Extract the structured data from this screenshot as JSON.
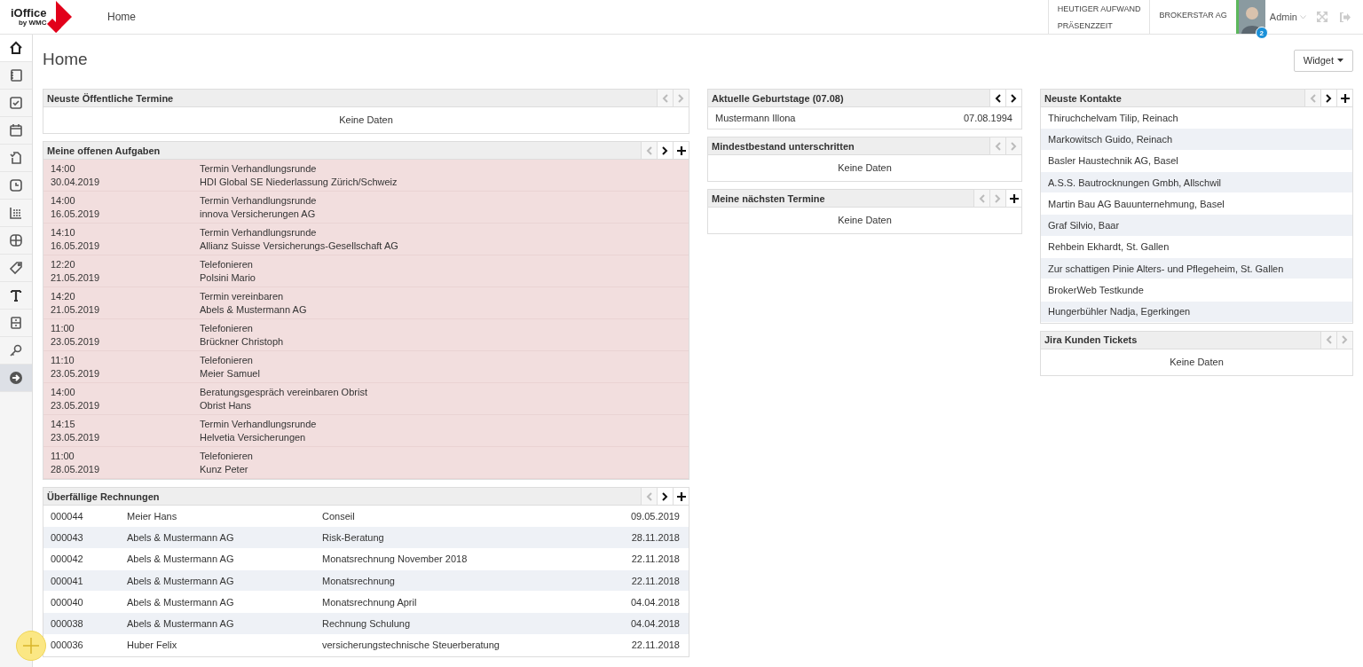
{
  "header": {
    "logo": {
      "name": "iOffice",
      "tagline": "by WMC"
    },
    "title": "Home",
    "stats": [
      "HEUTIGER AUFWAND",
      "PRÄSENZZEIT"
    ],
    "company": "BROKERSTAR AG",
    "user": {
      "name": "Admin",
      "badge": "2"
    }
  },
  "sidebar": {
    "items": [
      {
        "selected": false
      },
      {
        "selected": false
      },
      {
        "selected": false
      },
      {
        "selected": false
      },
      {
        "selected": false
      },
      {
        "selected": false
      },
      {
        "selected": false
      },
      {
        "selected": false
      },
      {
        "selected": false
      },
      {
        "selected": false
      },
      {
        "selected": false
      },
      {
        "selected": false
      },
      {
        "selected": true
      }
    ]
  },
  "page": {
    "title": "Home",
    "widget_button": "Widget"
  },
  "columns": [
    [
      {
        "kind": "empty",
        "title": "Neuste Öffentliche Termine",
        "buttons": [
          {
            "kind": "prev",
            "disabled": true
          },
          {
            "kind": "next",
            "disabled": true
          }
        ],
        "message": "Keine Daten"
      },
      {
        "kind": "tasks",
        "title": "Meine offenen Aufgaben",
        "buttons": [
          {
            "kind": "prev",
            "disabled": true
          },
          {
            "kind": "next",
            "disabled": false
          },
          {
            "kind": "add",
            "disabled": false
          }
        ],
        "rows": [
          {
            "time": "14:00",
            "date": "30.04.2019",
            "title": "Termin Verhandlungsrunde",
            "subject": "HDI Global SE Niederlassung Zürich/Schweiz"
          },
          {
            "time": "14:00",
            "date": "16.05.2019",
            "title": "Termin Verhandlungsrunde",
            "subject": "innova Versicherungen AG"
          },
          {
            "time": "14:10",
            "date": "16.05.2019",
            "title": "Termin Verhandlungsrunde",
            "subject": "Allianz Suisse Versicherungs-Gesellschaft AG"
          },
          {
            "time": "12:20",
            "date": "21.05.2019",
            "title": "Telefonieren",
            "subject": "Polsini Mario"
          },
          {
            "time": "14:20",
            "date": "21.05.2019",
            "title": "Termin vereinbaren",
            "subject": "Abels & Mustermann AG"
          },
          {
            "time": "11:00",
            "date": "23.05.2019",
            "title": "Telefonieren",
            "subject": "Brückner Christoph"
          },
          {
            "time": "11:10",
            "date": "23.05.2019",
            "title": "Telefonieren",
            "subject": "Meier Samuel"
          },
          {
            "time": "14:00",
            "date": "23.05.2019",
            "title": "Beratungsgespräch vereinbaren Obrist",
            "subject": "Obrist Hans"
          },
          {
            "time": "14:15",
            "date": "23.05.2019",
            "title": "Termin Verhandlungsrunde",
            "subject": "Helvetia Versicherungen"
          },
          {
            "time": "11:00",
            "date": "28.05.2019",
            "title": "Telefonieren",
            "subject": "Kunz Peter"
          }
        ]
      },
      {
        "kind": "table",
        "title": "Überfällige Rechnungen",
        "buttons": [
          {
            "kind": "prev",
            "disabled": true
          },
          {
            "kind": "next",
            "disabled": false
          },
          {
            "kind": "add",
            "disabled": false
          }
        ],
        "rows": [
          [
            "000044",
            "Meier Hans",
            "Conseil",
            "09.05.2019"
          ],
          [
            "000043",
            "Abels & Mustermann AG",
            "Risk-Beratung",
            "28.11.2018"
          ],
          [
            "000042",
            "Abels & Mustermann AG",
            "Monatsrechnung November 2018",
            "22.11.2018"
          ],
          [
            "000041",
            "Abels & Mustermann AG",
            "Monatsrechnung",
            "22.11.2018"
          ],
          [
            "000040",
            "Abels & Mustermann AG",
            "Monatsrechnung April",
            "04.04.2018"
          ],
          [
            "000038",
            "Abels & Mustermann AG",
            "Rechnung Schulung",
            "04.04.2018"
          ],
          [
            "000036",
            "Huber Felix",
            "versicherungstechnische Steuerberatung",
            "22.11.2018"
          ]
        ]
      }
    ],
    [
      {
        "kind": "table",
        "title": "Aktuelle Geburtstage (07.08)",
        "buttons": [
          {
            "kind": "prev",
            "disabled": false
          },
          {
            "kind": "next",
            "disabled": false
          }
        ],
        "rows": [
          [
            "Mustermann Illona",
            "07.08.1994"
          ]
        ]
      },
      {
        "kind": "empty",
        "title": "Mindestbestand unterschritten",
        "buttons": [
          {
            "kind": "prev",
            "disabled": true
          },
          {
            "kind": "next",
            "disabled": true
          }
        ],
        "message": "Keine Daten"
      },
      {
        "kind": "empty",
        "title": "Meine nächsten Termine",
        "buttons": [
          {
            "kind": "prev",
            "disabled": true
          },
          {
            "kind": "next",
            "disabled": true
          },
          {
            "kind": "add",
            "disabled": false
          }
        ],
        "message": "Keine Daten"
      }
    ],
    [
      {
        "kind": "list",
        "title": "Neuste Kontakte",
        "buttons": [
          {
            "kind": "prev",
            "disabled": true
          },
          {
            "kind": "next",
            "disabled": false
          },
          {
            "kind": "add",
            "disabled": false
          }
        ],
        "rows": [
          "Thiruchchelvam Tilip, Reinach",
          "Markowitsch Guido, Reinach",
          "Basler Haustechnik AG, Basel",
          "A.S.S. Bautrocknungen Gmbh, Allschwil",
          "Martin Bau AG Bauunternehmung, Basel",
          "Graf Silvio, Baar",
          "Rehbein Ekhardt, St. Gallen",
          "Zur schattigen Pinie Alters- und Pflegeheim, St. Gallen",
          "BrokerWeb Testkunde",
          "Hungerbühler Nadja, Egerkingen"
        ]
      },
      {
        "kind": "empty",
        "title": "Jira Kunden Tickets",
        "buttons": [
          {
            "kind": "prev",
            "disabled": true
          },
          {
            "kind": "next",
            "disabled": true
          }
        ],
        "message": "Keine Daten"
      }
    ]
  ]
}
